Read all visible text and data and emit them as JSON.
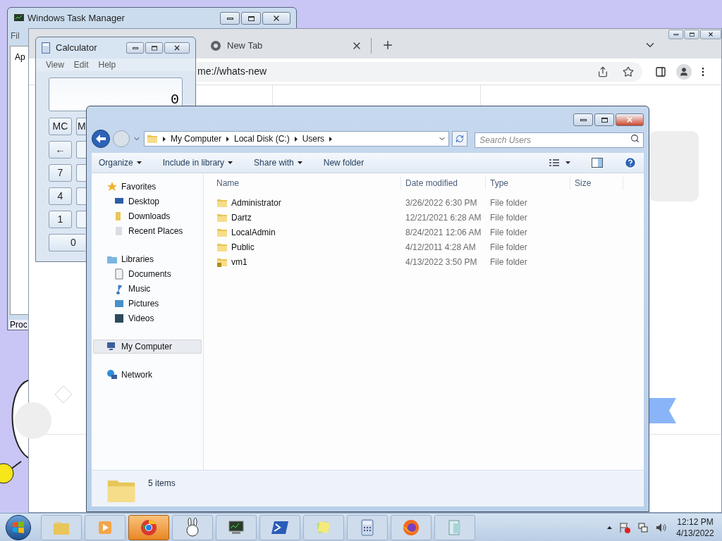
{
  "task_manager": {
    "title": "Windows Task Manager",
    "menu": [
      "Fil"
    ],
    "tab": "Ap",
    "bottom_tab": "Proc"
  },
  "chrome": {
    "tabs": [
      {
        "title": "New Tab",
        "selected": false
      }
    ],
    "address": "me://whats-new"
  },
  "calculator": {
    "title": "Calculator",
    "menu": [
      "View",
      "Edit",
      "Help"
    ],
    "display": "0",
    "rows": [
      [
        {
          "label": "MC",
          "kind": "normal"
        },
        {
          "label": "M",
          "kind": "normal"
        }
      ],
      [
        {
          "label": "←",
          "kind": "normal"
        }
      ],
      [
        {
          "label": "7",
          "kind": "normal"
        }
      ],
      [
        {
          "label": "4",
          "kind": "normal"
        }
      ],
      [
        {
          "label": "1",
          "kind": "normal"
        }
      ],
      [
        {
          "label": "0",
          "kind": "wide"
        }
      ]
    ]
  },
  "explorer": {
    "breadcrumb": [
      "My Computer",
      "Local Disk (C:)",
      "Users"
    ],
    "search": {
      "placeholder": "Search Users"
    },
    "toolbar": [
      {
        "label": "Organize",
        "dropdown": true
      },
      {
        "label": "Include in library",
        "dropdown": true
      },
      {
        "label": "Share with",
        "dropdown": true
      },
      {
        "label": "New folder",
        "dropdown": false
      }
    ],
    "sidebar": [
      {
        "label": "Favorites",
        "selected": false,
        "children": [
          {
            "label": "Desktop",
            "selected": false
          },
          {
            "label": "Downloads",
            "selected": false
          },
          {
            "label": "Recent Places",
            "selected": false
          }
        ]
      },
      {
        "label": "Libraries",
        "selected": false,
        "children": [
          {
            "label": "Documents",
            "selected": false
          },
          {
            "label": "Music",
            "selected": false
          },
          {
            "label": "Pictures",
            "selected": false
          },
          {
            "label": "Videos",
            "selected": false
          }
        ]
      },
      {
        "label": "My Computer",
        "selected": true
      },
      {
        "label": "Network",
        "selected": false
      }
    ],
    "columns": [
      "Name",
      "Date modified",
      "Type",
      "Size"
    ],
    "rows": [
      {
        "name": "Administrator",
        "date": "3/26/2022 6:30 PM",
        "type": "File folder",
        "locked": false
      },
      {
        "name": "Dartz",
        "date": "12/21/2021 6:28 AM",
        "type": "File folder",
        "locked": false
      },
      {
        "name": "LocalAdmin",
        "date": "8/24/2021 12:06 AM",
        "type": "File folder",
        "locked": false
      },
      {
        "name": "Public",
        "date": "4/12/2011 4:28 AM",
        "type": "File folder",
        "locked": false
      },
      {
        "name": "vm1",
        "date": "4/13/2022 3:50 PM",
        "type": "File folder",
        "locked": true
      }
    ],
    "status": "5 items"
  },
  "taskbar": {
    "buttons": [
      {
        "selected": false
      },
      {
        "selected": false
      },
      {
        "selected": true
      },
      {
        "selected": false
      },
      {
        "selected": false
      },
      {
        "selected": false
      },
      {
        "selected": false
      },
      {
        "selected": false
      },
      {
        "selected": false
      },
      {
        "selected": false
      }
    ],
    "clock": {
      "time": "12:12 PM",
      "date": "4/13/2022"
    }
  }
}
